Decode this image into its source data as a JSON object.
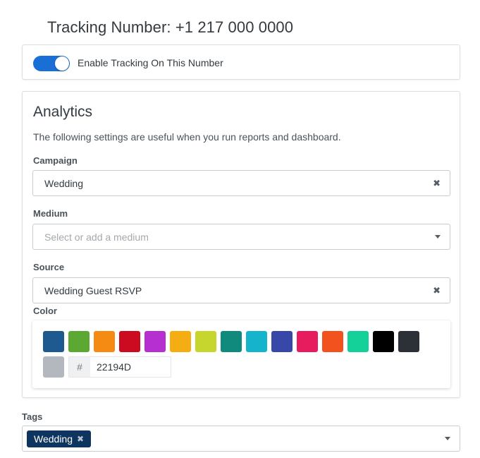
{
  "header": {
    "title": "Tracking Number: +1 217 000 0000"
  },
  "tracking": {
    "toggle_on": true,
    "label": "Enable Tracking On This Number"
  },
  "analytics": {
    "title": "Analytics",
    "description": "The following settings are useful when you run reports and dashboard.",
    "campaign": {
      "label": "Campaign",
      "value": "Wedding",
      "icon": "clear-icon"
    },
    "medium": {
      "label": "Medium",
      "placeholder": "Select or add a medium",
      "icon": "chevron-down-icon"
    },
    "source": {
      "label": "Source",
      "value": "Wedding Guest RSVP",
      "icon": "clear-icon"
    },
    "color": {
      "label": "Color",
      "swatches": [
        "#1e5a8f",
        "#5ba832",
        "#f58b12",
        "#cc0b20",
        "#b52fd1",
        "#f4ae13",
        "#c7d62f",
        "#0f8a7c",
        "#15b4cc",
        "#3848a8",
        "#e71c5f",
        "#f2521e",
        "#14d19a",
        "#000000",
        "#2b3137",
        "#b2b8bd"
      ],
      "hex_prefix": "#",
      "hex_value": "22194D"
    }
  },
  "tags": {
    "label": "Tags",
    "items": [
      "Wedding"
    ]
  },
  "colors": {
    "accent": "#1a6fd6",
    "tag_bg": "#0e3560"
  }
}
